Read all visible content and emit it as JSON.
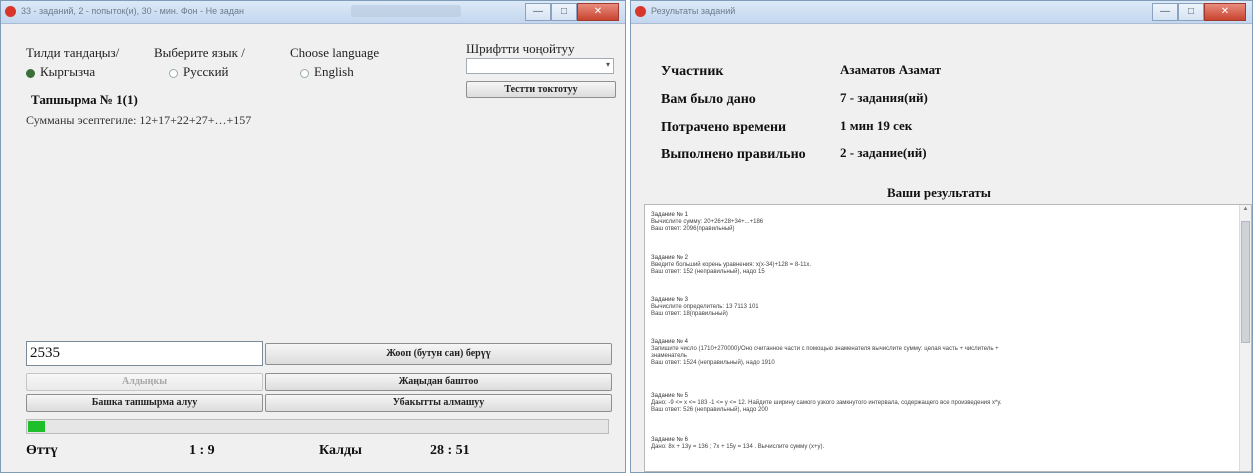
{
  "left_window": {
    "title": "33 - заданий, 2 - попыток(и), 30 - мин. Фон - Не задан",
    "title_controls": [
      "—",
      "□",
      "✕"
    ],
    "lang_headers": [
      "Тилди тандаңыз/",
      "Выберите язык /",
      "Choose language"
    ],
    "languages": [
      {
        "label": "Кыргызча",
        "selected": true
      },
      {
        "label": "Русский",
        "selected": false
      },
      {
        "label": "English",
        "selected": false
      }
    ],
    "font_label": "Шрифтти чоңойтуу",
    "font_combo_value": "",
    "font_button": "Тестти токтотуу",
    "task_title": "Тапшырма №  1(1)",
    "task_text": "Сумманы эсептегиле: 12+17+22+27+…+157",
    "answer_value": "2535",
    "btn_answer": "Жооп (бутун сан) берүү",
    "btn_prev": "Алдыңкы",
    "btn_next": "Жаңыдан баштоо",
    "btn_skip": "Башка тапшырма алуу",
    "btn_finish": "Убакытты алмашуу",
    "progress_fraction": 0.03,
    "progress_color": "#1fbf2c",
    "status": {
      "passed_label": "Өттү",
      "passed_value": "1 : 9",
      "left_label": "Калды",
      "left_value": "28 : 51"
    }
  },
  "right_window": {
    "title": "Результаты заданий",
    "title_controls": [
      "—",
      "□",
      "✕"
    ],
    "info": [
      {
        "label": "Участник",
        "value": "Азаматов Азамат"
      },
      {
        "label": "Вам было дано",
        "value": "7 - задания(ий)"
      },
      {
        "label": "Потрачено времени",
        "value": "1 мин 19 сек"
      },
      {
        "label": "Выполнено правильно",
        "value": "2 - задание(ий)"
      }
    ],
    "results_heading": "Ваши результаты",
    "tasks": [
      {
        "num": "Задание № 1",
        "q": "Вычислите сумму:  20+26+28+34+...+186",
        "a": "Ваш ответ:           2096(правильный)"
      },
      {
        "num": "Задание № 2",
        "q": "Введите больший корень уравнения:  x(x-34)+128 = 8-11x.",
        "a": "Ваш ответ:           152 (неправильный), надо 15"
      },
      {
        "num": "Задание № 3",
        "q": "Вычислите определитель:  13        7113    101",
        "a": "Ваш ответ:           18(правильный)"
      },
      {
        "num": "Задание № 4",
        "q": "Запишите число (1710+270000)/Оно считанное части с помощью знаменателя вычислите сумму: целая часть + числитель +",
        "q2": "знаменатель",
        "a": "Ваш ответ:           1524 (неправильный), надо 1910"
      },
      {
        "num": "Задание № 5",
        "q": "Дано: -9 <= x <= 183 -1 <= y <= 12. Найдите ширину самого узкого замкнутого интервала,   содержащего все произведения x*y.",
        "a": "Ваш ответ:           526 (неправильный), надо 200"
      },
      {
        "num": "Задание № 6",
        "q": "Дано: 8x + 13y = 136 ;     7x + 15y = 134 .    Вычислите сумму (x+y).",
        "a": ""
      }
    ]
  }
}
